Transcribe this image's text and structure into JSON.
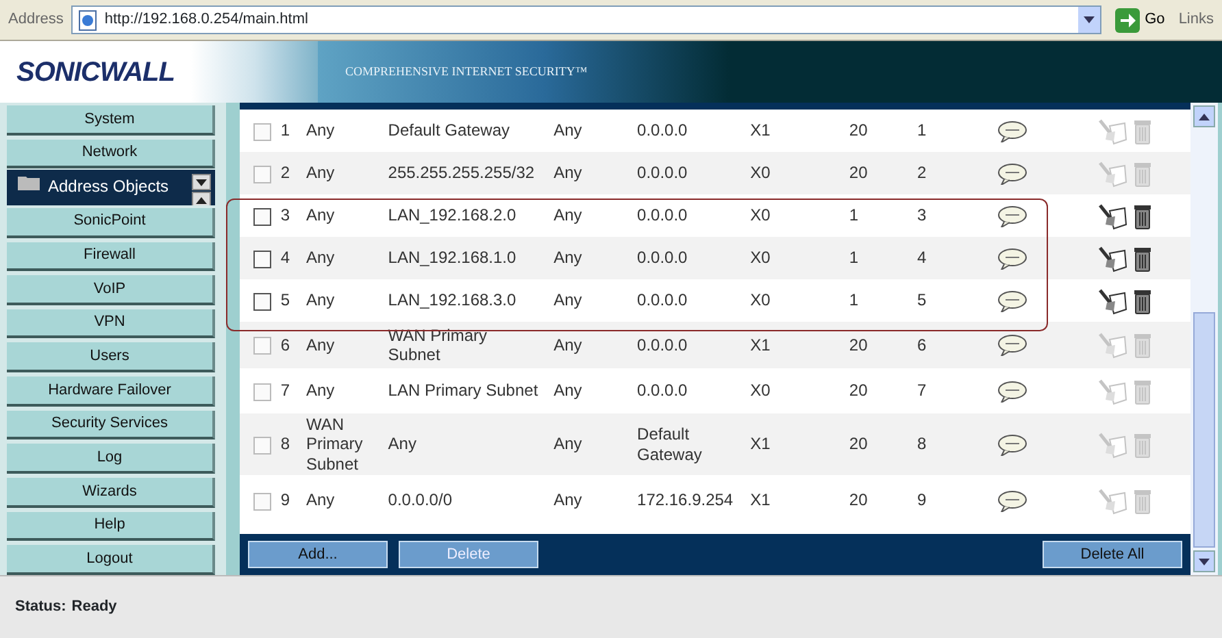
{
  "address_bar": {
    "label": "Address",
    "url": "http://192.168.0.254/main.html",
    "go": "Go",
    "links": "Links"
  },
  "banner": {
    "logo": "SONICWALL",
    "tagline": "COMPREHENSIVE INTERNET SECURITY™"
  },
  "nav": [
    {
      "kind": "button",
      "label": "System"
    },
    {
      "kind": "button",
      "label": "Network"
    },
    {
      "kind": "subitem",
      "label": "Address Objects"
    },
    {
      "kind": "button",
      "label": "SonicPoint"
    },
    {
      "kind": "button",
      "label": "Firewall"
    },
    {
      "kind": "button",
      "label": "VoIP"
    },
    {
      "kind": "button",
      "label": "VPN"
    },
    {
      "kind": "button",
      "label": "Users"
    },
    {
      "kind": "button",
      "label": "Hardware Failover"
    },
    {
      "kind": "button",
      "label": "Security Services"
    },
    {
      "kind": "button",
      "label": "Log"
    },
    {
      "kind": "button",
      "label": "Wizards"
    },
    {
      "kind": "button",
      "label": "Help"
    },
    {
      "kind": "button",
      "label": "Logout"
    }
  ],
  "table": {
    "rows": [
      {
        "checked": false,
        "enabled": false,
        "highlighted": false,
        "cells": [
          "1",
          "Any",
          "Default Gateway",
          "Any",
          "0.0.0.0",
          "X1",
          "20",
          "1"
        ]
      },
      {
        "checked": false,
        "enabled": false,
        "highlighted": false,
        "cells": [
          "2",
          "Any",
          "255.255.255.255/32",
          "Any",
          "0.0.0.0",
          "X0",
          "20",
          "2"
        ]
      },
      {
        "checked": false,
        "enabled": true,
        "highlighted": true,
        "cells": [
          "3",
          "Any",
          "LAN_192.168.2.0",
          "Any",
          "0.0.0.0",
          "X0",
          "1",
          "3"
        ]
      },
      {
        "checked": false,
        "enabled": true,
        "highlighted": true,
        "cells": [
          "4",
          "Any",
          "LAN_192.168.1.0",
          "Any",
          "0.0.0.0",
          "X0",
          "1",
          "4"
        ]
      },
      {
        "checked": false,
        "enabled": true,
        "highlighted": true,
        "cells": [
          "5",
          "Any",
          "LAN_192.168.3.0",
          "Any",
          "0.0.0.0",
          "X0",
          "1",
          "5"
        ]
      },
      {
        "checked": false,
        "enabled": false,
        "highlighted": false,
        "cells": [
          "6",
          "Any",
          "WAN Primary Subnet",
          "Any",
          "0.0.0.0",
          "X1",
          "20",
          "6"
        ]
      },
      {
        "checked": false,
        "enabled": false,
        "highlighted": false,
        "cells": [
          "7",
          "Any",
          "LAN Primary Subnet",
          "Any",
          "0.0.0.0",
          "X0",
          "20",
          "7"
        ]
      },
      {
        "checked": false,
        "enabled": false,
        "highlighted": false,
        "cells": [
          "8",
          "WAN Primary Subnet",
          "Any",
          "Any",
          "Default Gateway",
          "X1",
          "20",
          "8"
        ]
      },
      {
        "checked": false,
        "enabled": false,
        "highlighted": false,
        "cells": [
          "9",
          "Any",
          "0.0.0.0/0",
          "Any",
          "172.16.9.254",
          "X1",
          "20",
          "9"
        ]
      }
    ]
  },
  "buttons": [
    {
      "label": "Add...",
      "disabled": false
    },
    {
      "label": "Delete",
      "disabled": true
    },
    {
      "label": "Delete All",
      "disabled": false
    }
  ],
  "status": {
    "label": "Status:",
    "value": "Ready"
  }
}
